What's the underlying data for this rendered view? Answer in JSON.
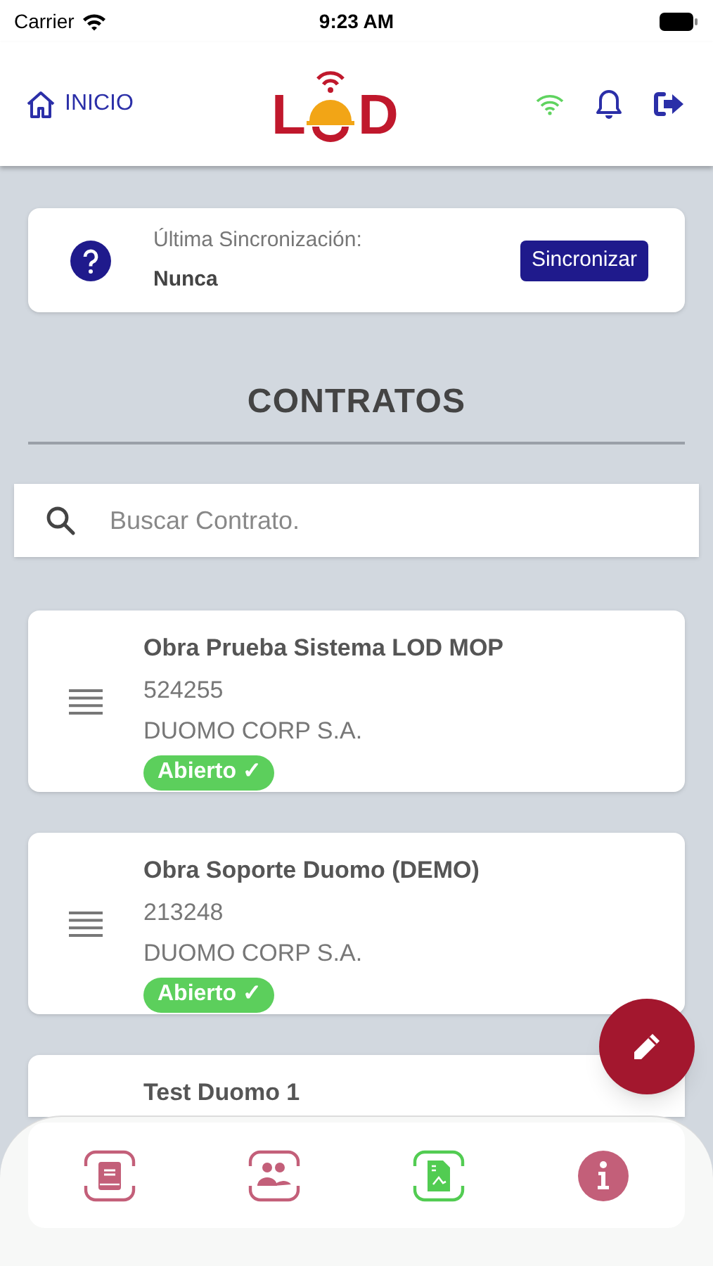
{
  "status_bar": {
    "carrier": "Carrier",
    "time": "9:23 AM"
  },
  "header": {
    "home_label": "INICIO",
    "logo": {
      "left": "L",
      "right": "D"
    },
    "online": true
  },
  "sync": {
    "label": "Última Sincronización:",
    "value": "Nunca",
    "button": "Sincronizar"
  },
  "section_title": "CONTRATOS",
  "search": {
    "placeholder": "Buscar Contrato."
  },
  "contracts": [
    {
      "title": "Obra Prueba Sistema LOD MOP",
      "code": "524255",
      "company": "DUOMO CORP S.A.",
      "status": "Abierto ✓"
    },
    {
      "title": "Obra Soporte Duomo (DEMO)",
      "code": "213248",
      "company": "DUOMO CORP S.A.",
      "status": "Abierto ✓"
    },
    {
      "title": "Test Duomo 1"
    }
  ],
  "bottom_nav": [
    {
      "kind": "book",
      "selected": false
    },
    {
      "kind": "people",
      "selected": false
    },
    {
      "kind": "document",
      "selected": true
    },
    {
      "kind": "info",
      "selected": false
    }
  ]
}
